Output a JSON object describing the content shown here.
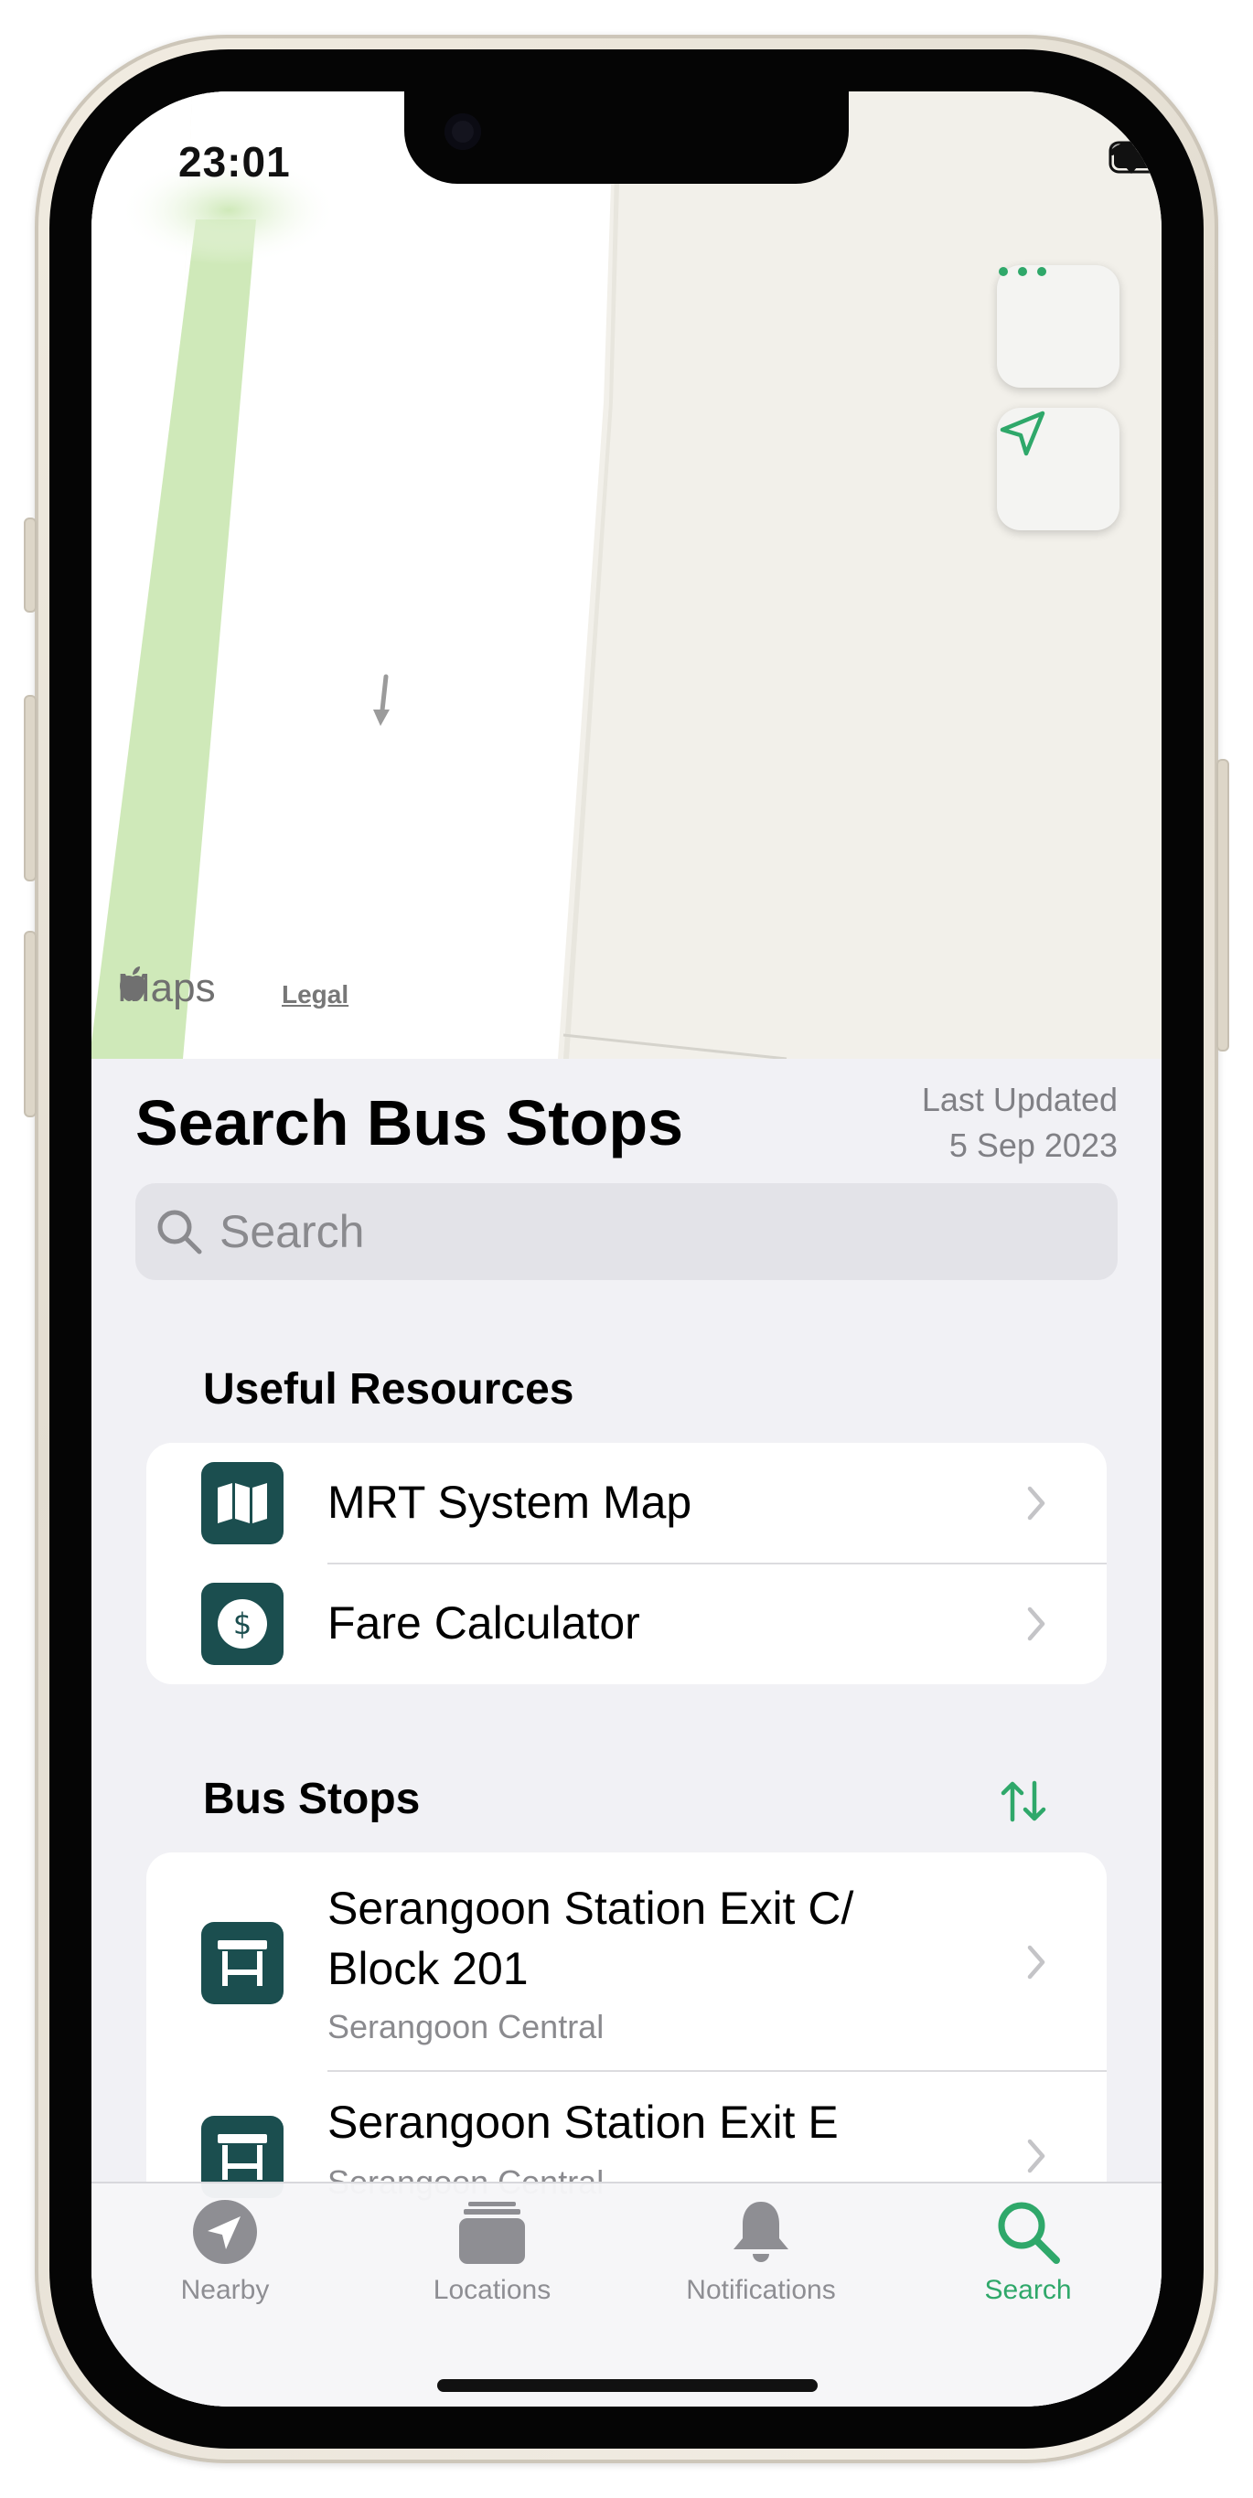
{
  "status_bar": {
    "time": "23:01"
  },
  "map": {
    "attribution_brand": "Maps",
    "legal_link": "Legal",
    "more_button_icon": "ellipsis-icon",
    "locate_button_icon": "location-arrow-icon"
  },
  "header": {
    "title": "Search Bus Stops",
    "last_updated_label": "Last Updated",
    "last_updated_date": "5 Sep 2023"
  },
  "search": {
    "placeholder": "Search"
  },
  "useful_resources": {
    "header": "Useful Resources",
    "items": [
      {
        "label": "MRT System Map",
        "icon": "map-icon"
      },
      {
        "label": "Fare Calculator",
        "icon": "dollar-icon"
      }
    ]
  },
  "bus_stops": {
    "header": "Bus Stops",
    "sort_icon": "sort-arrows-icon",
    "items": [
      {
        "name_line1": "Serangoon Station Exit C/",
        "name_line2": "Block 201",
        "road": "Serangoon Central",
        "icon": "bus-stop-icon"
      },
      {
        "name_line1": "Serangoon Station Exit E",
        "road": "Serangoon Central",
        "icon": "bus-stop-icon"
      }
    ]
  },
  "tab_bar": {
    "tabs": [
      {
        "label": "Nearby",
        "icon": "location-arrow-icon",
        "active": false
      },
      {
        "label": "Locations",
        "icon": "stack-icon",
        "active": false
      },
      {
        "label": "Notifications",
        "icon": "bell-icon",
        "active": false
      },
      {
        "label": "Search",
        "icon": "magnifier-icon",
        "active": true
      }
    ]
  },
  "colors": {
    "accent": "#2fa86a",
    "icon_bg": "#1b4e4f",
    "park_green": "#cfe9b9",
    "map_bg": "#f2f0ea"
  }
}
